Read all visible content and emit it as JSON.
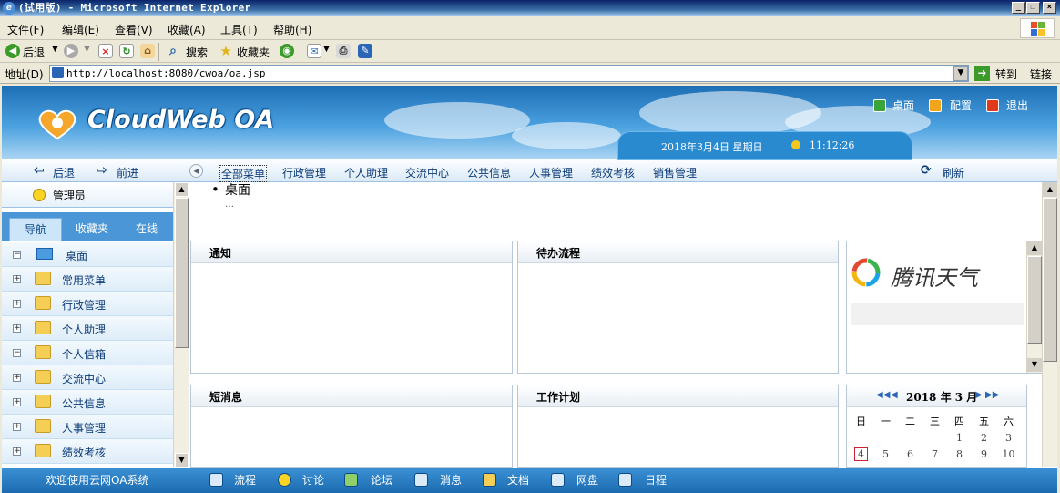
{
  "window": {
    "title": "(试用版) - Microsoft Internet Explorer"
  },
  "menu": [
    "文件(F)",
    "编辑(E)",
    "查看(V)",
    "收藏(A)",
    "工具(T)",
    "帮助(H)"
  ],
  "toolbar": {
    "back": "后退",
    "search": "搜索",
    "favorites": "收藏夹"
  },
  "address": {
    "label": "地址(D)",
    "url": "http://localhost:8080/cwoa/oa.jsp",
    "go": "转到",
    "links": "链接"
  },
  "header": {
    "logo": "CloudWeb OA",
    "desktop": "桌面",
    "config": "配置",
    "logout": "退出",
    "date": "2018年3月4日  星期日",
    "time": "11:12:26"
  },
  "nav": {
    "back": "后退",
    "forward": "前进",
    "items": [
      "全部菜单",
      "行政管理",
      "个人助理",
      "交流中心",
      "公共信息",
      "人事管理",
      "绩效考核",
      "销售管理"
    ],
    "refresh": "刷新"
  },
  "sidebar": {
    "user": "管理员",
    "tabs": [
      "导航",
      "收藏夹",
      "在线"
    ],
    "items": [
      {
        "label": "桌面",
        "expand": "−"
      },
      {
        "label": "常用菜单",
        "expand": "+"
      },
      {
        "label": "行政管理",
        "expand": "+"
      },
      {
        "label": "个人助理",
        "expand": "+"
      },
      {
        "label": "个人信箱",
        "expand": "−"
      },
      {
        "label": "交流中心",
        "expand": "+"
      },
      {
        "label": "公共信息",
        "expand": "+"
      },
      {
        "label": "人事管理",
        "expand": "+"
      },
      {
        "label": "绩效考核",
        "expand": "+"
      }
    ]
  },
  "content": {
    "breadcrumb": "桌面",
    "ellipsis": "…",
    "panels": {
      "notice": "通知",
      "pending": "待办流程",
      "messages": "短消息",
      "plan": "工作计划"
    },
    "weather": "腾讯天气",
    "calendar": {
      "title": "2018 年 3 月",
      "weekdays": [
        "日",
        "一",
        "二",
        "三",
        "四",
        "五",
        "六"
      ],
      "rows": [
        [
          "",
          "",
          "",
          "",
          "1",
          "2",
          "3"
        ],
        [
          "4",
          "5",
          "6",
          "7",
          "8",
          "9",
          "10"
        ]
      ],
      "today": "4"
    }
  },
  "footer": {
    "welcome": "欢迎使用云网OA系统",
    "items": [
      "流程",
      "讨论",
      "论坛",
      "消息",
      "文档",
      "网盘",
      "日程"
    ]
  }
}
